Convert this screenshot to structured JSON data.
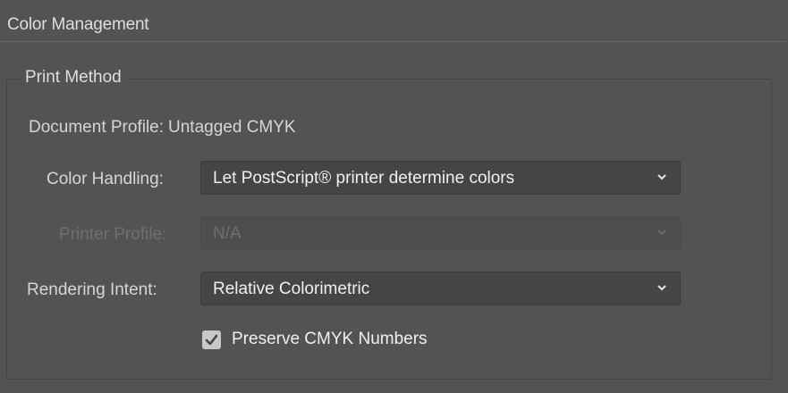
{
  "section": {
    "title": "Color Management"
  },
  "print_method": {
    "title": "Print Method",
    "document_profile": {
      "label": "Document Profile:",
      "value": "Untagged CMYK"
    },
    "color_handling": {
      "label": "Color Handling:",
      "value": "Let PostScript® printer determine colors",
      "enabled": true
    },
    "printer_profile": {
      "label": "Printer Profile:",
      "value": "N/A",
      "enabled": false
    },
    "rendering_intent": {
      "label": "Rendering Intent:",
      "value": "Relative Colorimetric",
      "enabled": true
    },
    "preserve_cmyk": {
      "label": "Preserve CMYK Numbers",
      "checked": true
    }
  },
  "icons": {
    "dropdown": "chevron-down-icon",
    "checkbox": "checkmark-icon"
  },
  "colors": {
    "panel_background": "#535353",
    "control_background": "#454545",
    "text": "#d6d6d6",
    "text_disabled": "#6f6f6f"
  }
}
